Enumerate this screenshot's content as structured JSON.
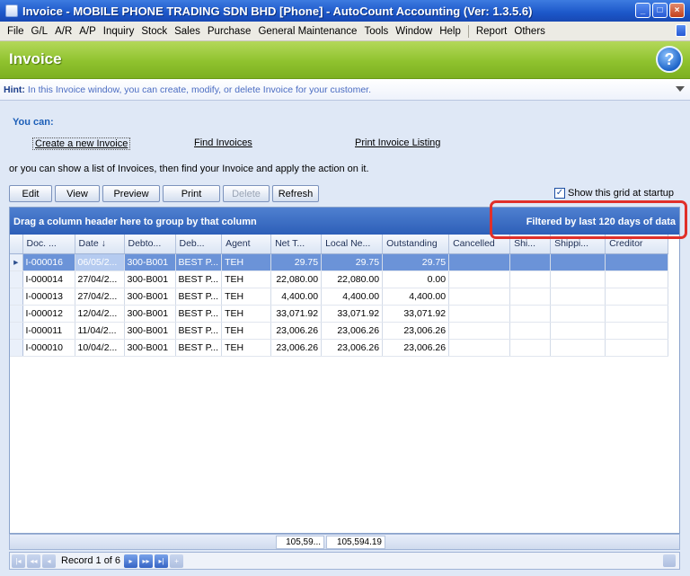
{
  "window": {
    "title": "Invoice - MOBILE PHONE TRADING SDN BHD [Phone] - AutoCount Accounting (Ver: 1.3.5.6)",
    "controls": [
      "_",
      "□",
      "×"
    ]
  },
  "menu": [
    "File",
    "G/L",
    "A/R",
    "A/P",
    "Inquiry",
    "Stock",
    "Sales",
    "Purchase",
    "General Maintenance",
    "Tools",
    "Window",
    "Help",
    "Report",
    "Others"
  ],
  "header": {
    "title": "Invoice",
    "help_icon": "?"
  },
  "hint": {
    "label": "Hint:",
    "text": "In this Invoice window, you can create, modify, or delete Invoice for your customer."
  },
  "actions": {
    "you_can": "You can:",
    "create": "Create a new Invoice",
    "find": "Find Invoices",
    "print_listing": "Print Invoice Listing",
    "or_text": "or you can show a list of Invoices, then find your Invoice and apply the action on it."
  },
  "toolbar": {
    "edit": "Edit",
    "view": "View",
    "preview": "Preview",
    "print": "Print",
    "delete": "Delete",
    "refresh": "Refresh",
    "show_grid": "Show this grid at startup",
    "show_grid_checked": "✓"
  },
  "grid": {
    "group_hint": "Drag a column header here to group by that column",
    "filter": "Filtered by last 120 days of data",
    "columns": [
      "Doc. ...",
      "Date",
      "Debto...",
      "Deb...",
      "Agent",
      "Net T...",
      "Local Ne...",
      "Outstanding",
      "Cancelled",
      "Shi...",
      "Shippi...",
      "Creditor"
    ],
    "sort_icon": "↓",
    "row_indicator": "▸",
    "rows": [
      [
        "I-000016",
        "06/05/2...",
        "300-B001",
        "BEST P...",
        "TEH",
        "29.75",
        "29.75",
        "29.75",
        "",
        "",
        "",
        ""
      ],
      [
        "I-000014",
        "27/04/2...",
        "300-B001",
        "BEST P...",
        "TEH",
        "22,080.00",
        "22,080.00",
        "0.00",
        "",
        "",
        "",
        ""
      ],
      [
        "I-000013",
        "27/04/2...",
        "300-B001",
        "BEST P...",
        "TEH",
        "4,400.00",
        "4,400.00",
        "4,400.00",
        "",
        "",
        "",
        ""
      ],
      [
        "I-000012",
        "12/04/2...",
        "300-B001",
        "BEST P...",
        "TEH",
        "33,071.92",
        "33,071.92",
        "33,071.92",
        "",
        "",
        "",
        ""
      ],
      [
        "I-000011",
        "11/04/2...",
        "300-B001",
        "BEST P...",
        "TEH",
        "23,006.26",
        "23,006.26",
        "23,006.26",
        "",
        "",
        "",
        ""
      ],
      [
        "I-000010",
        "10/04/2...",
        "300-B001",
        "BEST P...",
        "TEH",
        "23,006.26",
        "23,006.26",
        "23,006.26",
        "",
        "",
        "",
        ""
      ]
    ],
    "totals": {
      "net_total": "105,59...",
      "local_net_total": "105,594.19"
    }
  },
  "navigator": {
    "record_text": "Record 1 of 6",
    "buttons": [
      "|◂",
      "◂◂",
      "◂",
      "▸",
      "▸▸",
      "▸|",
      "+"
    ]
  }
}
